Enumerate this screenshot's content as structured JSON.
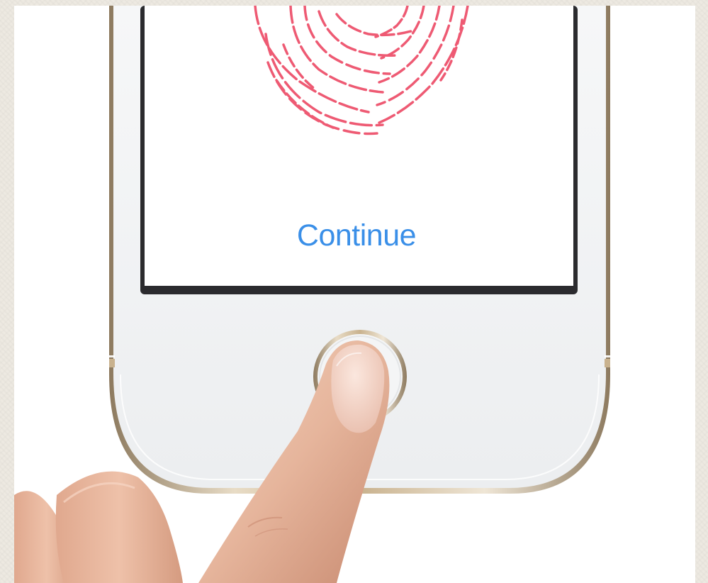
{
  "screen": {
    "continue_label": "Continue"
  },
  "colors": {
    "link_blue": "#3a8fe8",
    "fingerprint": "#ee5a73",
    "gold_trim": "#c9b28e"
  },
  "icons": {
    "fingerprint": "fingerprint-icon",
    "home_button": "home-button-ring"
  }
}
